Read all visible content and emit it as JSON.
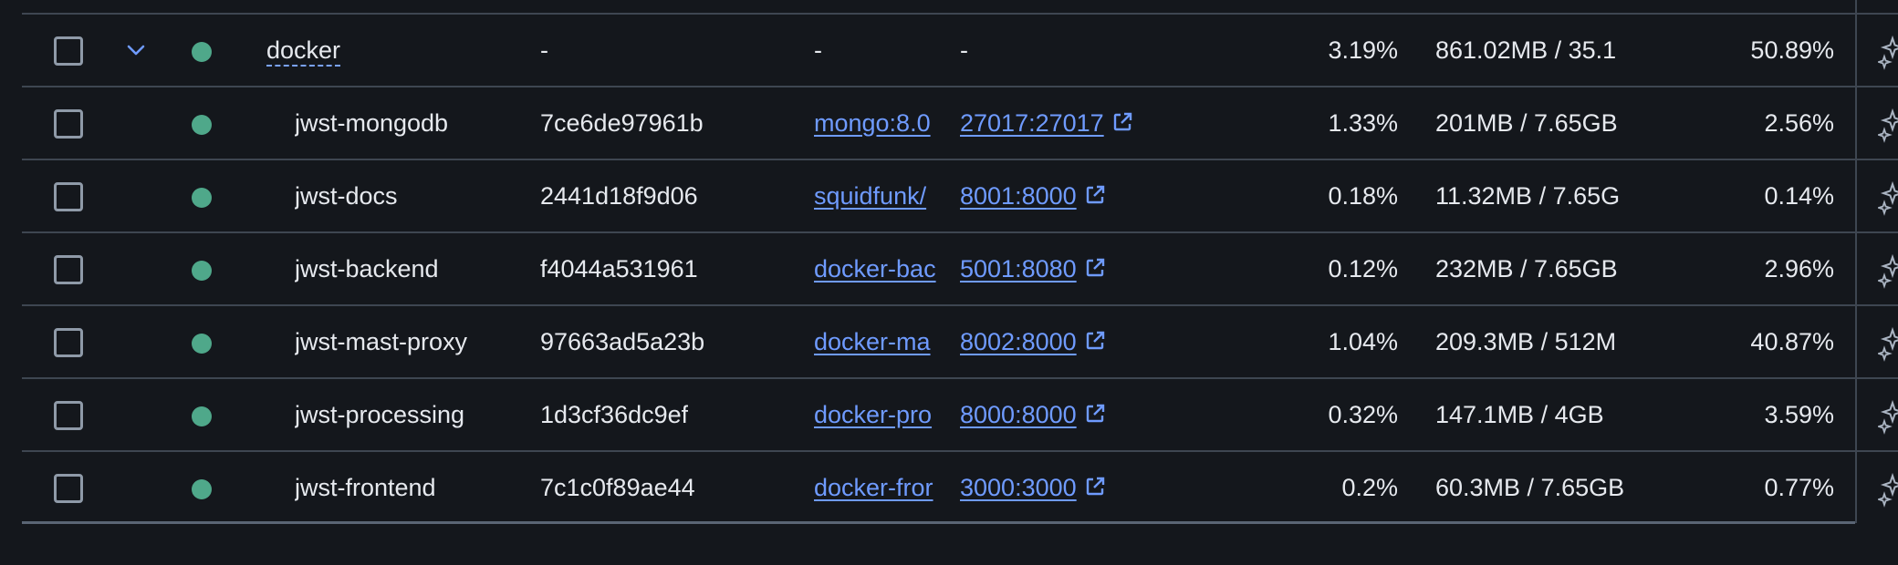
{
  "colors": {
    "background": "#14171c",
    "text": "#e6e9ee",
    "link": "#6f9bff",
    "status_running": "#4fa88a",
    "divider": "#3e4651"
  },
  "rows": [
    {
      "name": "docker",
      "container_id": "-",
      "image": "-",
      "port": "-",
      "cpu": "3.19%",
      "memory": "861.02MB / 35.1",
      "memory_pct": "50.89%",
      "expanded": true,
      "group": true,
      "status": "running"
    },
    {
      "name": "jwst-mongodb",
      "container_id": "7ce6de97961b",
      "image": "mongo:8.0",
      "port": "27017:27017",
      "cpu": "1.33%",
      "memory": "201MB / 7.65GB",
      "memory_pct": "2.56%",
      "status": "running"
    },
    {
      "name": "jwst-docs",
      "container_id": "2441d18f9d06",
      "image": "squidfunk/",
      "port": "8001:8000",
      "cpu": "0.18%",
      "memory": "11.32MB / 7.65G",
      "memory_pct": "0.14%",
      "status": "running"
    },
    {
      "name": "jwst-backend",
      "container_id": "f4044a531961",
      "image": "docker-bac",
      "port": "5001:8080",
      "cpu": "0.12%",
      "memory": "232MB / 7.65GB",
      "memory_pct": "2.96%",
      "status": "running"
    },
    {
      "name": "jwst-mast-proxy",
      "container_id": "97663ad5a23b",
      "image": "docker-ma",
      "port": "8002:8000",
      "cpu": "1.04%",
      "memory": "209.3MB / 512M",
      "memory_pct": "40.87%",
      "status": "running"
    },
    {
      "name": "jwst-processing",
      "container_id": "1d3cf36dc9ef",
      "image": "docker-pro",
      "port": "8000:8000",
      "cpu": "0.32%",
      "memory": "147.1MB / 4GB",
      "memory_pct": "3.59%",
      "status": "running"
    },
    {
      "name": "jwst-frontend",
      "container_id": "7c1c0f89ae44",
      "image": "docker-fror",
      "port": "3000:3000",
      "cpu": "0.2%",
      "memory": "60.3MB / 7.65GB",
      "memory_pct": "0.77%",
      "status": "running"
    }
  ]
}
